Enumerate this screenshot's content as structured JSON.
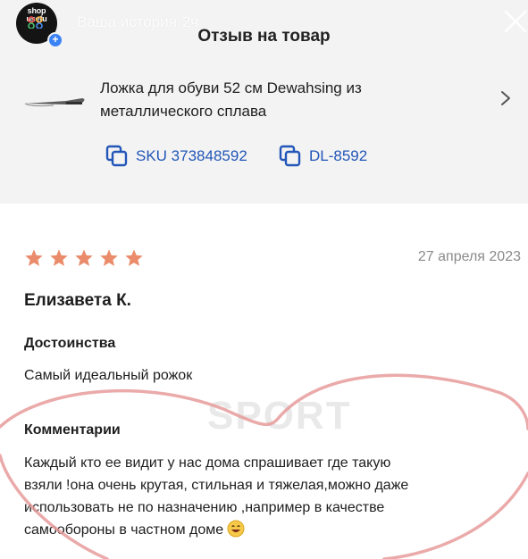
{
  "story_bar": {
    "avatar_text": "shop\nusefu",
    "label": "Ваша история",
    "time": "2ч"
  },
  "page": {
    "title": "Отзыв на товар"
  },
  "product": {
    "name_line1": "Ложка для обуви 52 см Dewahsing из",
    "name_line2": "металлического сплава",
    "sku": "SKU 373848592",
    "article": "DL-8592"
  },
  "review": {
    "rating": 5,
    "date": "27 апреля 2023",
    "author": "Елизавета К.",
    "pros_heading": "Достоинства",
    "pros_text": "Самый идеальный рожок",
    "comments_heading": "Комментарии",
    "comment_line1": "Каждый кто ее видит у нас дома спрашивает где такую",
    "comment_line2": "взяли !она очень крутая, стильная и тяжелая,можно даже",
    "comment_line3": "использовать не по назначению ,например в качестве",
    "comment_line4": "самообороны в частном доме"
  },
  "colors": {
    "link_blue": "#2256b8",
    "star_orange": "#ea8c6c",
    "heart_pink": "#e79b9b"
  },
  "icons": [
    "close-icon",
    "chevron-right-icon",
    "copy-icon",
    "star-icon",
    "smile-emoji-icon"
  ]
}
